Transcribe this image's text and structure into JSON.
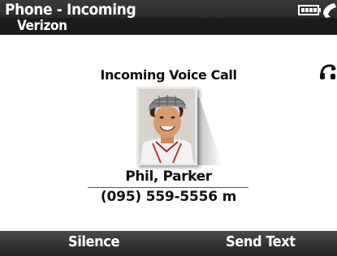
{
  "titlebar": {
    "title": "Phone - Incoming",
    "icons": [
      "battery-icon",
      "phone-signal-icon"
    ]
  },
  "carrier": {
    "name": "Verizon"
  },
  "call": {
    "heading": "Incoming Voice Call",
    "caller_name": "Phil, Parker",
    "caller_number": "(095) 559-5556 m",
    "status_icon": "headset-icon"
  },
  "softkeys": {
    "left_label": "Silence",
    "right_label": "Send Text"
  },
  "colors": {
    "titlebar_bg": "#1a1a1a",
    "softkey_bg": "#2a2a2a",
    "text": "#111111"
  }
}
